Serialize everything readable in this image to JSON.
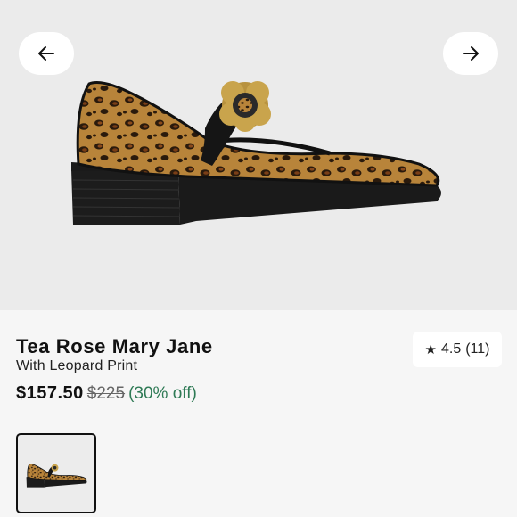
{
  "product": {
    "name": "Tea Rose Mary Jane",
    "subtitle": "With Leopard Print",
    "price": "$157.50",
    "original_price": "$225",
    "discount": "(30% off)"
  },
  "rating": {
    "value": "4.5",
    "count": "(11)"
  },
  "gallery": {
    "prev_icon": "arrow-left-icon",
    "next_icon": "arrow-right-icon"
  },
  "colors": {
    "discount": "#2e7a55",
    "hero_background": "#ebebeb"
  }
}
